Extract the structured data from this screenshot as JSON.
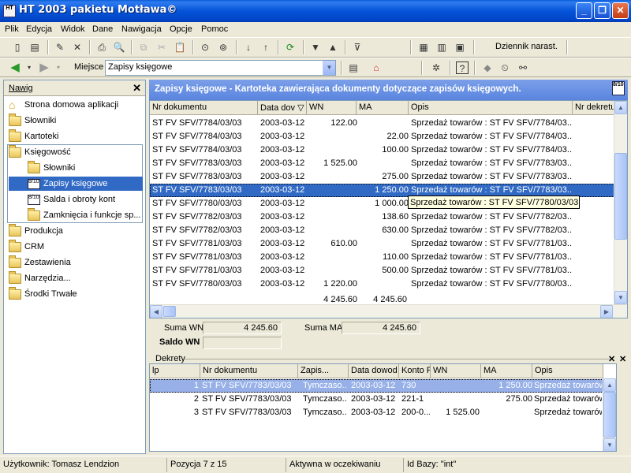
{
  "window": {
    "title": "HT 2003 pakietu Motława©",
    "icon_text": "HT"
  },
  "menu": [
    "Plik",
    "Edycja",
    "Widok",
    "Dane",
    "Nawigacja",
    "Opcje",
    "Pomoc"
  ],
  "toolbar": {
    "journal_label": "Dziennik narast."
  },
  "location": {
    "label": "Miejsce",
    "value": "Zapisy księgowe"
  },
  "nav": {
    "title": "Nawig",
    "items": [
      "Strona domowa aplikacji",
      "Słowniki",
      "Kartoteki",
      "Księgowość",
      "Słowniki",
      "Zapisy księgowe",
      "Salda i obroty kont",
      "Zamknięcia i funkcje sp...",
      "Produkcja",
      "CRM",
      "Zestawienia",
      "Narzędzia...",
      "Środki Trwałe"
    ]
  },
  "main": {
    "title": "Zapisy księgowe - Kartoteka zawierająca dokumenty dotyczące zapisów księgowych.",
    "columns": [
      "Nr dokumentu",
      "Data dov ▽",
      "WN",
      "MA",
      "Opis",
      "Nr dekretu"
    ],
    "rows": [
      [
        "ST FV SFV/7784/03/03",
        "2003-03-12",
        "122.00",
        "",
        "Sprzedaż towarów : ST FV SFV/7784/03..."
      ],
      [
        "ST FV SFV/7784/03/03",
        "2003-03-12",
        "",
        "22.00",
        "Sprzedaż towarów : ST FV SFV/7784/03..."
      ],
      [
        "ST FV SFV/7784/03/03",
        "2003-03-12",
        "",
        "100.00",
        "Sprzedaż towarów : ST FV SFV/7784/03..."
      ],
      [
        "ST FV SFV/7783/03/03",
        "2003-03-12",
        "1 525.00",
        "",
        "Sprzedaż towarów : ST FV SFV/7783/03..."
      ],
      [
        "ST FV SFV/7783/03/03",
        "2003-03-12",
        "",
        "275.00",
        "Sprzedaż towarów : ST FV SFV/7783/03..."
      ],
      [
        "ST FV SFV/7783/03/03",
        "2003-03-12",
        "",
        "1 250.00",
        "Sprzedaż towarów : ST FV SFV/7783/03..."
      ],
      [
        "ST FV SFV/7780/03/03",
        "2003-03-12",
        "",
        "1 000.00",
        "Sprzedaż towarów : ST FV SFV/7780/03..."
      ],
      [
        "ST FV SFV/7782/03/03",
        "2003-03-12",
        "",
        "138.60",
        "Sprzedaż towarów : ST FV SFV/7782/03..."
      ],
      [
        "ST FV SFV/7782/03/03",
        "2003-03-12",
        "",
        "630.00",
        "Sprzedaż towarów : ST FV SFV/7782/03..."
      ],
      [
        "ST FV SFV/7781/03/03",
        "2003-03-12",
        "610.00",
        "",
        "Sprzedaż towarów : ST FV SFV/7781/03..."
      ],
      [
        "ST FV SFV/7781/03/03",
        "2003-03-12",
        "",
        "110.00",
        "Sprzedaż towarów : ST FV SFV/7781/03..."
      ],
      [
        "ST FV SFV/7781/03/03",
        "2003-03-12",
        "",
        "500.00",
        "Sprzedaż towarów : ST FV SFV/7781/03..."
      ],
      [
        "ST FV SFV/7780/03/03",
        "2003-03-12",
        "1 220.00",
        "",
        "Sprzedaż towarów : ST FV SFV/7780/03..."
      ]
    ],
    "selected_row": 5,
    "totals": {
      "wn": "4 245.60",
      "ma": "4 245.60"
    },
    "tooltip": "Sprzedaż towarów : ST FV SFV/7780/03/03"
  },
  "sums": {
    "wn_label": "Suma WN",
    "wn": "4 245.60",
    "ma_label": "Suma MA",
    "ma": "4 245.60",
    "saldo_label": "Saldo WN",
    "saldo": ""
  },
  "dekrety": {
    "title": "Dekrety",
    "columns": [
      "lp",
      "Nr dokumentu",
      "Zapis...",
      "Data dowod",
      "Konto F",
      "WN",
      "MA",
      "Opis"
    ],
    "rows": [
      [
        "1",
        "ST FV SFV/7783/03/03",
        "Tymczaso...",
        "2003-03-12",
        "730",
        "",
        "1 250.00",
        "Sprzedaż towarów"
      ],
      [
        "2",
        "ST FV SFV/7783/03/03",
        "Tymczaso...",
        "2003-03-12",
        "221-1",
        "",
        "275.00",
        "Sprzedaż towarów"
      ],
      [
        "3",
        "ST FV SFV/7783/03/03",
        "Tymczaso...",
        "2003-03-12",
        "200-0...",
        "1 525.00",
        "",
        "Sprzedaż towarów"
      ]
    ]
  },
  "status": {
    "user": "Użytkownik: Tomasz Lendzion",
    "position": "Pozycja 7 z 15",
    "state": "Aktywna w oczekiwaniu",
    "db": "Id Bazy: \"int\""
  },
  "colors": {
    "selection": "#316ac5",
    "header_blue": "#6b93e4",
    "titlebar": "#0553d8"
  }
}
